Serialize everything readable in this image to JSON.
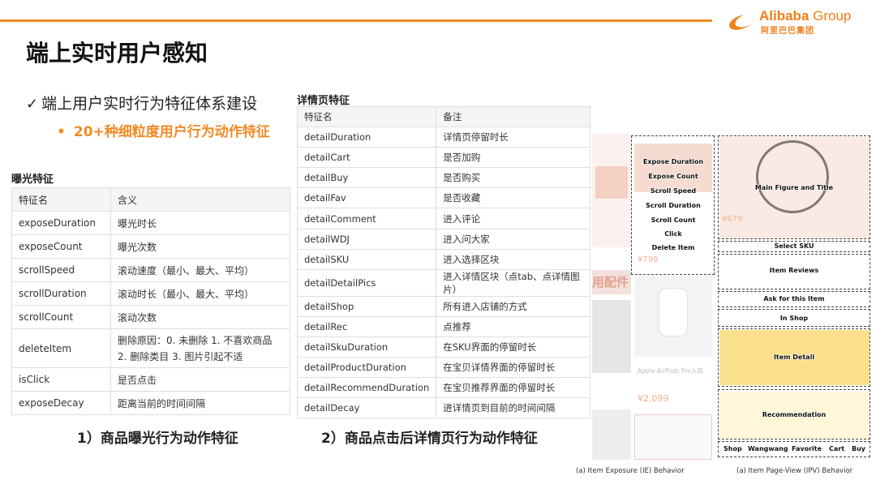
{
  "header": {
    "brand": "Alibaba",
    "brand_group": " Group",
    "brand_cn": "阿里巴巴集团"
  },
  "page_title": "端上实时用户感知",
  "bullet": "端上用户实时行为特征体系建设",
  "sub_bullet": "20+种细粒度用户行为动作特征",
  "expose_section": {
    "label": "曝光特征",
    "headers": [
      "特征名",
      "含义"
    ],
    "rows": [
      [
        "exposeDuration",
        "曝光时长"
      ],
      [
        "exposeCount",
        "曝光次数"
      ],
      [
        "scrollSpeed",
        "滚动速度（最小、最大、平均）"
      ],
      [
        "scrollDuration",
        "滚动时长（最小、最大、平均）"
      ],
      [
        "scrollCount",
        "滚动次数"
      ],
      [
        "deleteItem",
        "删除原因：0. 未删除 1. 不喜欢商品 2. 删除类目 3. 图片引起不适"
      ],
      [
        "isClick",
        "是否点击"
      ],
      [
        "exposeDecay",
        "距离当前的时间间隔"
      ]
    ]
  },
  "detail_section": {
    "label": "详情页特征",
    "headers": [
      "特征名",
      "备注"
    ],
    "rows": [
      [
        "detailDuration",
        "详情页停留时长"
      ],
      [
        "detailCart",
        "是否加购"
      ],
      [
        "detailBuy",
        "是否购买"
      ],
      [
        "detailFav",
        "是否收藏"
      ],
      [
        "detailComment",
        "进入评论"
      ],
      [
        "detailWDJ",
        "进入问大家"
      ],
      [
        "detailSKU",
        "进入选择区块"
      ],
      [
        "detailDetailPics",
        "进入详情区块（点tab、点详情图片）"
      ],
      [
        "detailShop",
        "所有进入店铺的方式"
      ],
      [
        "detailRec",
        "点推荐"
      ],
      [
        "detailSkuDuration",
        "在SKU界面的停留时长"
      ],
      [
        "detailProductDuration",
        "在宝贝详情界面的停留时长"
      ],
      [
        "detailRecommendDuration",
        "在宝贝推荐界面的停留时长"
      ],
      [
        "detailDecay",
        "进详情页到目前的时间间隔"
      ]
    ]
  },
  "captions": {
    "expose": "1）商品曝光行为动作特征",
    "detail": "2）商品点击后详情页行为动作特征"
  },
  "figure": {
    "ie_labels": [
      "Expose Duration",
      "Expose Count",
      "Scroll Speed",
      "Scroll Duration",
      "Scroll Count",
      "Click",
      "Delete Item"
    ],
    "ipv_labels": {
      "main": "Main Figure and Title",
      "sku": "Select SKU",
      "reviews": "Item Reviews",
      "ask": "Ask for this Item",
      "shop": "In Shop",
      "detail": "Item Detail",
      "rec": "Recommendation",
      "bottom": [
        "Shop",
        "Wangwang",
        "Favorite",
        "Cart",
        "Buy"
      ]
    },
    "bg_texts": {
      "price1": "¥798",
      "price2": "¥679",
      "accessories": "用配件",
      "airpods": "Apple AirPods Pro入耳",
      "price3": "¥2,099"
    },
    "caption_ie": "(a) Item Exposure (IE) Behavior",
    "caption_ipv": "(a) Item Page-View (IPV) Behavior"
  },
  "colors": {
    "accent": "#f08a24",
    "brand": "#f07f18"
  }
}
